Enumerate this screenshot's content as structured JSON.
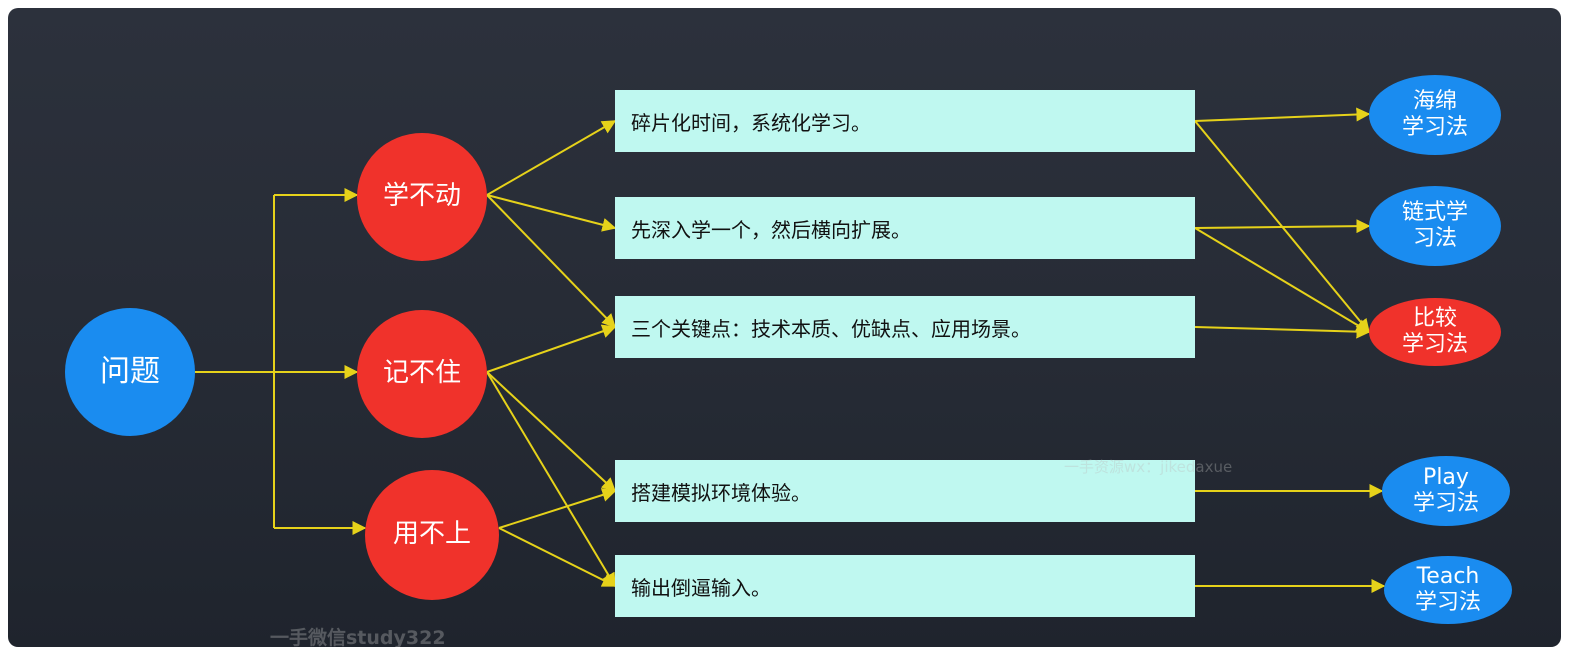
{
  "root": {
    "label": "问题"
  },
  "problems": [
    {
      "label": "学不动"
    },
    {
      "label": "记不住"
    },
    {
      "label": "用不上"
    }
  ],
  "solutions": [
    {
      "text": "碎片化时间，系统化学习。"
    },
    {
      "text": "先深入学一个，然后横向扩展。"
    },
    {
      "text": "三个关键点：技术本质、优缺点、应用场景。"
    },
    {
      "text": "搭建模拟环境体验。"
    },
    {
      "text": "输出倒逼输入。"
    }
  ],
  "methods": [
    {
      "line1": "海绵",
      "line2": "学习法",
      "color": "#1a8cf0"
    },
    {
      "line1": "链式学",
      "line2": "习法",
      "color": "#1a8cf0"
    },
    {
      "line1": "比较",
      "line2": "学习法",
      "color": "#f0322b"
    },
    {
      "line1": "Play",
      "line2": "学习法",
      "color": "#1a8cf0"
    },
    {
      "line1": "Teach",
      "line2": "学习法",
      "color": "#1a8cf0"
    }
  ],
  "watermarks": {
    "center": "一手资源wx：jikedaxue",
    "bottom": "一手微信study322"
  },
  "colors": {
    "connector": "#e6d21a",
    "box_fill": "#bff8f0",
    "blue": "#1a8cf0",
    "red": "#f0322b"
  }
}
